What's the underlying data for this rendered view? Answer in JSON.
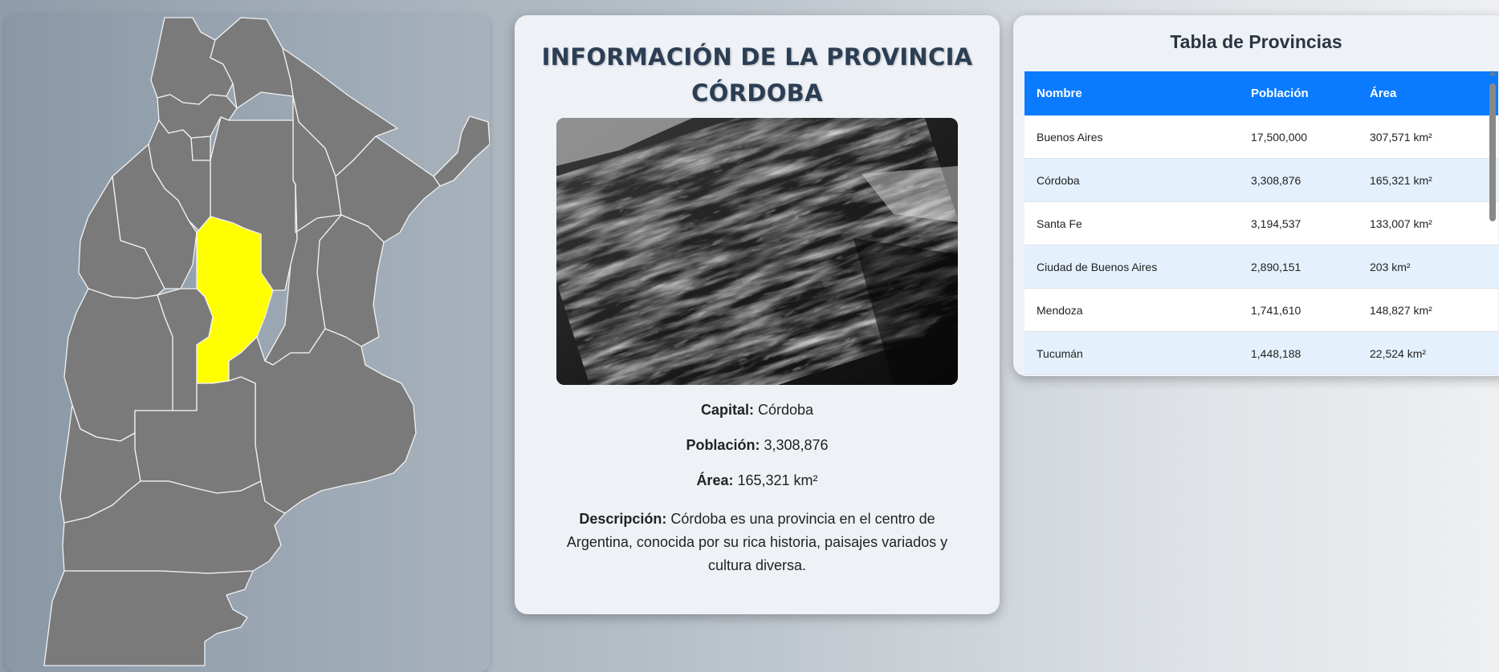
{
  "map": {
    "selected_province": "Córdoba",
    "colors": {
      "province": "#7a7a7a",
      "selected": "#ffff00",
      "border": "#f2f2f2"
    }
  },
  "info": {
    "title": "INFORMACIÓN DE LA PROVINCIA CÓRDOBA",
    "capital_label": "Capital:",
    "capital_value": "Córdoba",
    "population_label": "Población:",
    "population_value": "3,308,876",
    "area_label": "Área:",
    "area_value": "165,321 km²",
    "description_label": "Descripción:",
    "description_value": "Córdoba es una provincia en el centro de Argentina, conocida por su rica historia, paisajes variados y cultura diversa."
  },
  "table": {
    "title": "Tabla de Provincias",
    "headers": [
      "Nombre",
      "Población",
      "Área"
    ],
    "rows": [
      [
        "Buenos Aires",
        "17,500,000",
        "307,571 km²"
      ],
      [
        "Córdoba",
        "3,308,876",
        "165,321 km²"
      ],
      [
        "Santa Fe",
        "3,194,537",
        "133,007 km²"
      ],
      [
        "Ciudad de Buenos Aires",
        "2,890,151",
        "203 km²"
      ],
      [
        "Mendoza",
        "1,741,610",
        "148,827 km²"
      ],
      [
        "Tucumán",
        "1,448,188",
        "22,524 km²"
      ],
      [
        "",
        "",
        ""
      ]
    ],
    "header_color": "#0a7bff"
  }
}
